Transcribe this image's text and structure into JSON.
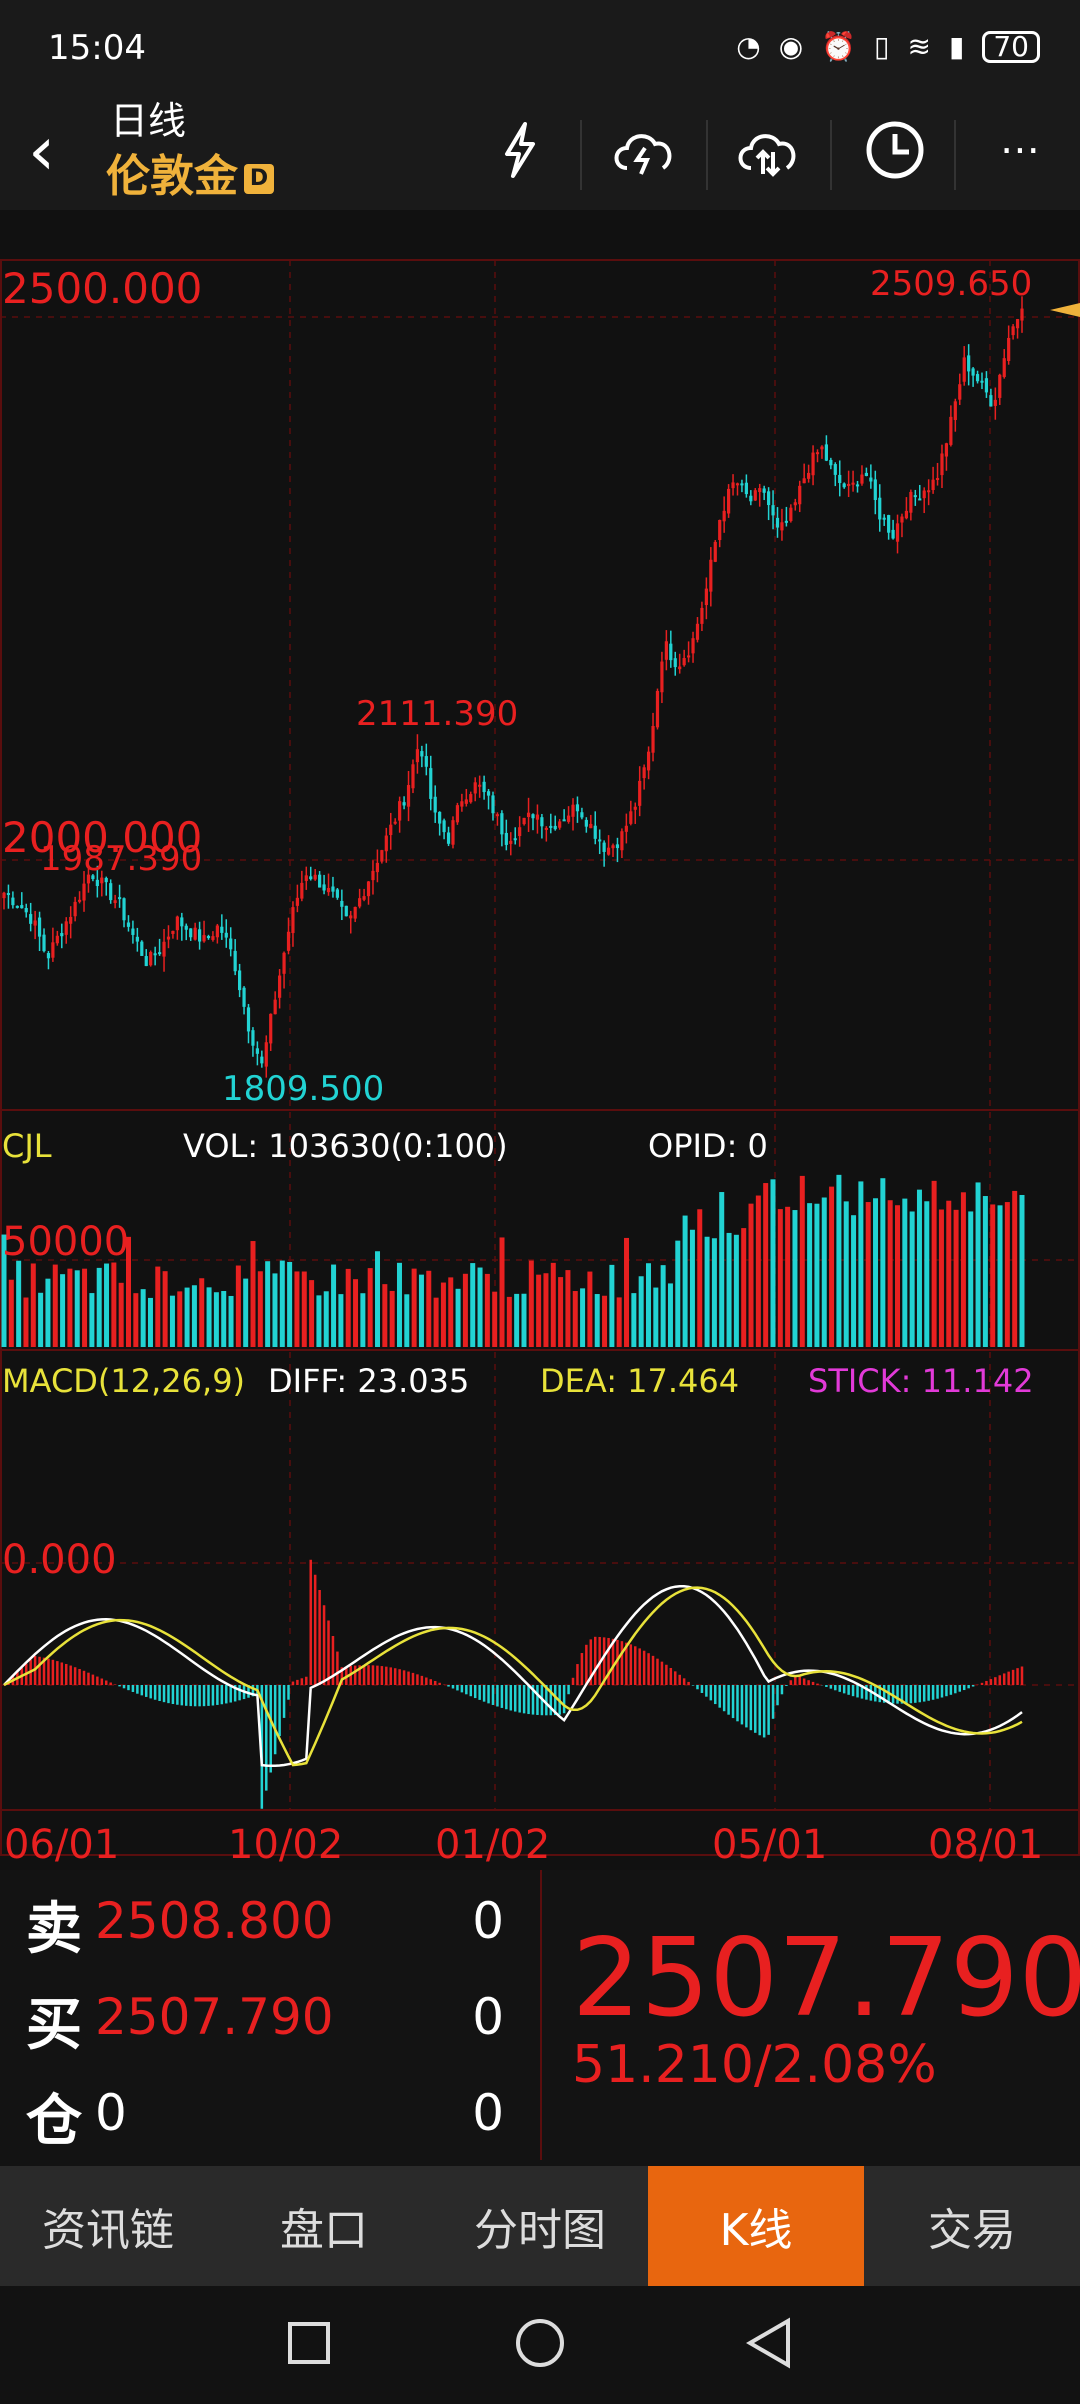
{
  "status_bar": {
    "time": "15:04",
    "battery": "70"
  },
  "header": {
    "period": "日线",
    "instrument": "伦敦金",
    "badge": "D"
  },
  "price_panel": {
    "top_price_label": "2509.650",
    "grid_label_2500": "2500.000",
    "grid_label_2000": "2000.000",
    "high_label": "2111.390",
    "left_label": "1987.390",
    "low_label": "1809.500"
  },
  "volume_panel": {
    "name": "CJL",
    "vol": "VOL: 103630(0:100)",
    "opid": "OPID: 0",
    "level": "50000"
  },
  "macd_panel": {
    "name": "MACD(12,26,9)",
    "diff": "DIFF: 23.035",
    "dea": "DEA: 17.464",
    "stick": "STICK: 11.142",
    "zero": "0.000"
  },
  "date_axis": [
    "06/01",
    "10/02",
    "01/02",
    "05/01",
    "08/01"
  ],
  "order_book": {
    "sell_key": "卖",
    "sell_price": "2508.800",
    "sell_qty": "0",
    "buy_key": "买",
    "buy_price": "2507.790",
    "buy_qty": "0",
    "pos_key": "仓",
    "pos_val": "0",
    "pos_qty": "0"
  },
  "last_price": "2507.790",
  "change": "51.210/2.08%",
  "tabs": [
    "资讯链",
    "盘口",
    "分时图",
    "K线",
    "交易"
  ],
  "active_tab": "K线",
  "colors": {
    "up": "#e82020",
    "down": "#22d3d3",
    "accent": "#f0b23b",
    "tab_active": "#e8660f"
  },
  "chart_data": {
    "type": "candlestick",
    "x_ticks": [
      "06/01",
      "10/02",
      "01/02",
      "05/01",
      "08/01"
    ],
    "y_ticks": [
      2000,
      2500
    ],
    "annotations": [
      {
        "label": "2509.650",
        "value": 2509.65
      },
      {
        "label": "2111.390",
        "value": 2111.39
      },
      {
        "label": "1987.390",
        "value": 1987.39
      },
      {
        "label": "1809.500",
        "value": 1809.5
      }
    ],
    "close_path": [
      1970,
      1960,
      1945,
      1910,
      1935,
      1960,
      1990,
      1975,
      1960,
      1930,
      1905,
      1920,
      1945,
      1935,
      1925,
      1940,
      1910,
      1850,
      1809.5,
      1880,
      1945,
      1990,
      1980,
      1965,
      1940,
      1970,
      2000,
      2030,
      2060,
      2111.39,
      2040,
      2020,
      2060,
      2070,
      2050,
      2020,
      2030,
      2045,
      2030,
      2040,
      2050,
      2030,
      2010,
      2020,
      2050,
      2100,
      2200,
      2180,
      2200,
      2250,
      2320,
      2350,
      2330,
      2340,
      2300,
      2320,
      2360,
      2380,
      2350,
      2340,
      2360,
      2320,
      2300,
      2330,
      2340,
      2350,
      2400,
      2460,
      2440,
      2420,
      2480,
      2509.65
    ],
    "volume_scale": [
      0,
      100000
    ],
    "macd": {
      "diff": 23.035,
      "dea": 17.464,
      "stick": 11.142
    }
  }
}
